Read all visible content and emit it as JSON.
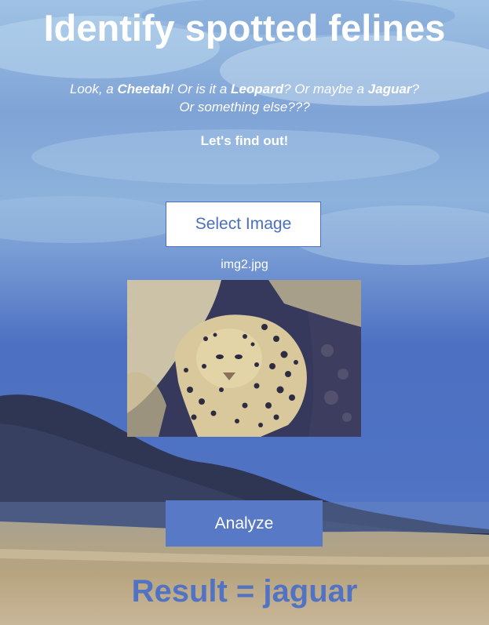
{
  "page": {
    "title": "Identify spotted felines"
  },
  "intro": {
    "part1": "Look, a ",
    "cat1": "Cheetah",
    "part2": "! Or is it a ",
    "cat2": "Leopard",
    "part3": "? Or maybe a ",
    "cat3": "Jaguar",
    "part4": "?",
    "line2": "Or something else???",
    "find_out": "Let's find out!"
  },
  "controls": {
    "select_label": "Select Image",
    "filename": "img2.jpg",
    "analyze_label": "Analyze"
  },
  "result": {
    "text": "Result = jaguar"
  },
  "colors": {
    "accent": "#5879c6",
    "result_text": "#5273c4",
    "sky": "#8fb3dc",
    "mountain": "#2e3553",
    "sand": "#b8a583"
  },
  "image_preview": {
    "subject": "jaguar photo"
  }
}
